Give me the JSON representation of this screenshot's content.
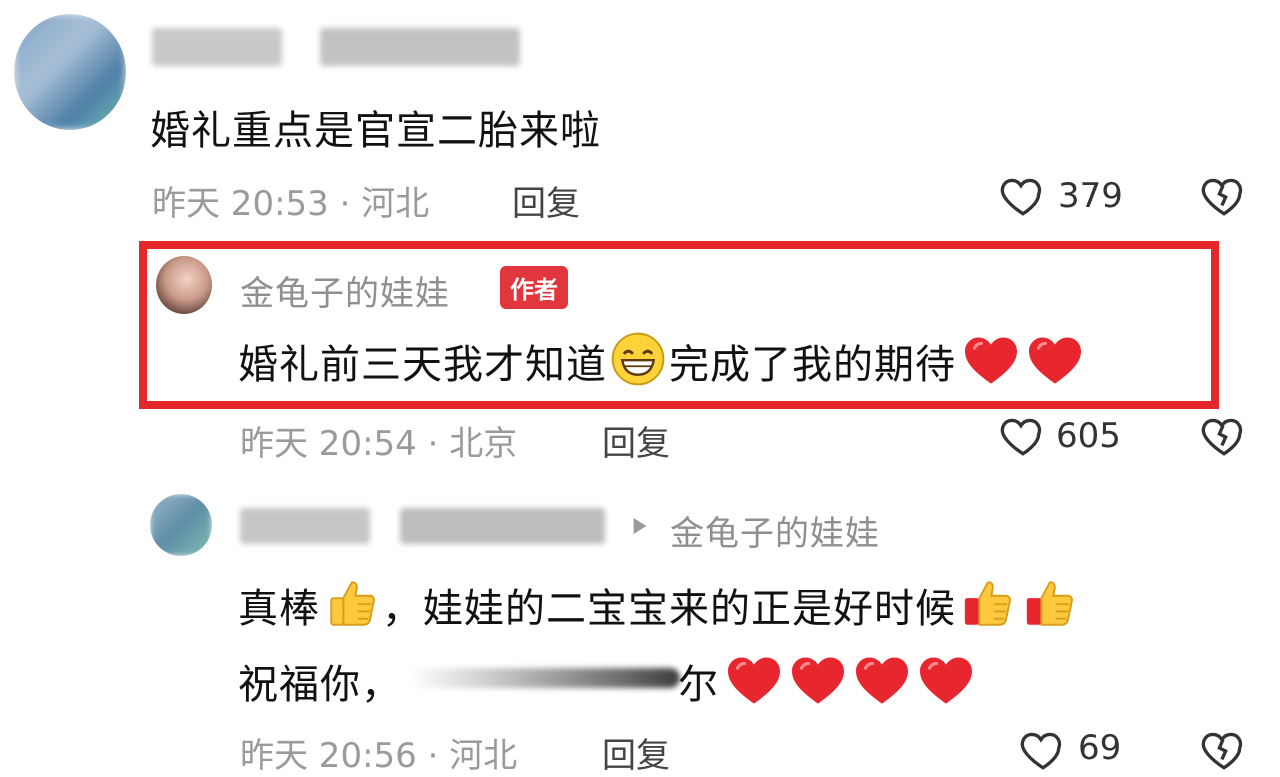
{
  "comments": [
    {
      "text": "婚礼重点是官宣二胎来啦",
      "meta": "昨天 20:53 · 河北",
      "reply_label": "回复",
      "likes": "379"
    },
    {
      "author": "金龟子的娃娃",
      "badge": "作者",
      "text_before": "婚礼前三天我才知道",
      "text_after": "完成了我的期待",
      "meta": "昨天 20:54 · 北京",
      "reply_label": "回复",
      "likes": "605"
    },
    {
      "reply_to": "金龟子的娃娃",
      "line1_a": "真棒",
      "line1_b": "，娃娃的二宝宝来的正是好时候",
      "line2_a": "祝福你，",
      "line2_b": "尔",
      "meta": "昨天 20:56 · 河北",
      "reply_label": "回复",
      "likes": "69"
    }
  ],
  "icons": {
    "like": "heart-outline-icon",
    "dislike": "broken-heart-icon",
    "reply_arrow": "triangle-right-icon"
  },
  "colors": {
    "highlight_border": "#e5262b",
    "badge_bg": "#e2363f",
    "heart_red": "#e8262e"
  }
}
